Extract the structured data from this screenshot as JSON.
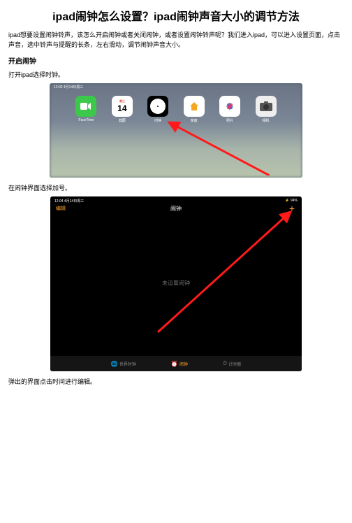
{
  "title": "ipad闹钟怎么设置？ipad闹钟声音大小的调节方法",
  "intro": "ipad想要设置闹钟铃声，该怎么开启闹钟或者关闭闹钟，或者设置闹钟铃声呢？我们进入ipad，可以进入设置页面，点击声音，选中铃声与提醒的长条，左右滑动，调节闹钟声音大小。",
  "section1": "开启闹钟",
  "step1": "打开ipad选择时钟。",
  "shot1": {
    "time": "12:02  4月14日周三",
    "apps": {
      "facetime": "FaceTime",
      "calendar_weekday": "周三",
      "calendar_day": "14",
      "calendar_label": "日历",
      "clock_label": "时钟",
      "home_label": "家庭",
      "photos_label": "照片",
      "camera_label": "相机"
    }
  },
  "step2": "在闹钟界面选择加号。",
  "shot2": {
    "time": "12:04  4月14日周三",
    "battery": "⚡ 94%",
    "edit": "编辑",
    "nav_title": "闹钟",
    "plus": "+",
    "empty": "未设置闹钟",
    "tabs": {
      "world": "世界时钟",
      "alarm": "闹钟",
      "timer": "计时器"
    }
  },
  "step3": "弹出的界面点击时间进行编辑。"
}
